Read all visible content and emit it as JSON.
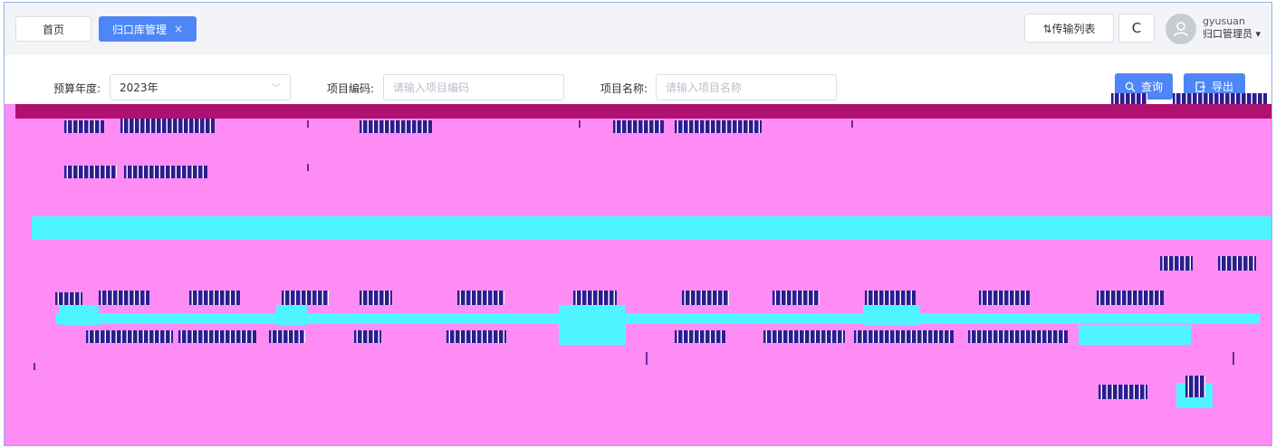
{
  "tabs": [
    {
      "label": "首页",
      "active": false
    },
    {
      "label": "归口库管理",
      "active": true,
      "close": "×"
    }
  ],
  "header": {
    "transfer_label": "⇅传输列表",
    "refresh_glyph": "C",
    "username": "gyusuan",
    "role": "归口管理员"
  },
  "search": {
    "year_label": "预算年度:",
    "year_value": "2023年",
    "code_label": "项目编码:",
    "code_placeholder": "请输入项目编码",
    "name_label": "项目名称:",
    "name_placeholder": "请输入项目名称",
    "query_button": "查询",
    "export_button": "导出"
  },
  "icons": {
    "refresh": "refresh-icon",
    "avatar": "user-avatar-icon",
    "chevron": "chevron-down-icon",
    "search": "search-icon",
    "export": "export-icon",
    "close": "close-icon"
  },
  "colors": {
    "primary": "#4f86f7",
    "mask_pink": "#ff8cf5",
    "mask_magenta": "#b0106f",
    "mask_cyan": "#4ef5ff"
  }
}
